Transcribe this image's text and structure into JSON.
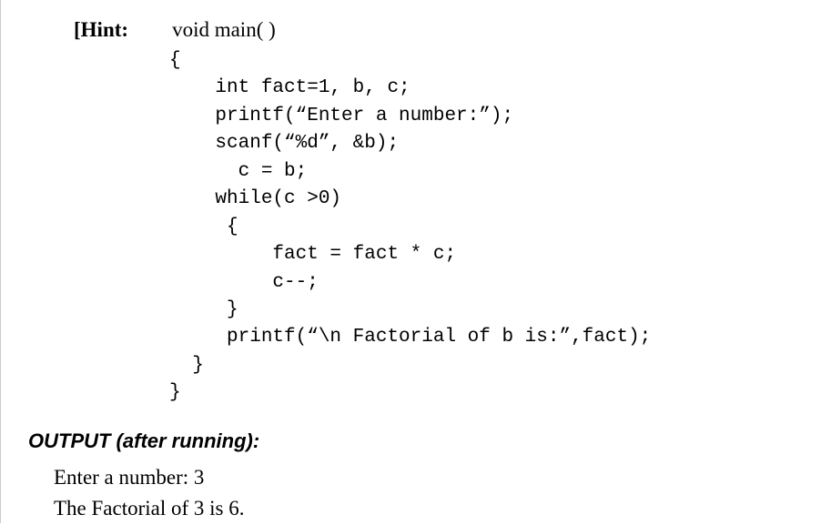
{
  "hint": {
    "label": "[Hint:",
    "signature": "void main( )"
  },
  "code": "{\n    int fact=1, b, c;\n    printf(“Enter a number:”);\n    scanf(“%d”, &b);\n      c = b;\n    while(c >0)\n     {\n         fact = fact * c;\n         c--;\n     }\n     printf(“\\n Factorial of b is:”,fact);\n  }\n}",
  "output": {
    "heading": "OUTPUT (after running):",
    "lines": [
      "Enter a number: 3",
      "The Factorial of 3 is 6."
    ]
  }
}
